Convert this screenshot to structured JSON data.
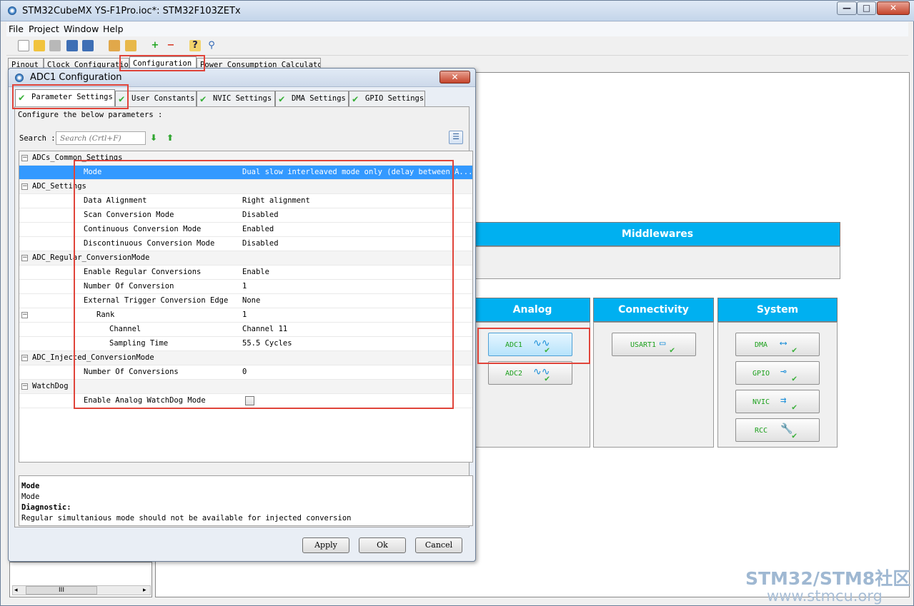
{
  "app": {
    "title": "STM32CubeMX YS-F1Pro.ioc*: STM32F103ZETx",
    "window_controls": {
      "minimize": "—",
      "maximize": "□",
      "close": "✕"
    }
  },
  "menu": [
    "File",
    "Project",
    "Window",
    "Help"
  ],
  "main_tabs": [
    "Pinout",
    "Clock Configuration",
    "Configuration",
    "Power Consumption Calculator"
  ],
  "categories": {
    "middlewares": "Middlewares",
    "analog": "Analog",
    "connectivity": "Connectivity",
    "system": "System"
  },
  "peripherals": {
    "adc1": "ADC1",
    "adc2": "ADC2",
    "usart1": "USART1",
    "dma": "DMA",
    "gpio": "GPIO",
    "nvic": "NVIC",
    "rcc": "RCC"
  },
  "dialog": {
    "title": "ADC1 Configuration",
    "close": "✕",
    "tabs": [
      "Parameter Settings",
      "User Constants",
      "NVIC Settings",
      "DMA Settings",
      "GPIO Settings"
    ],
    "configure_label": "Configure the below parameters :",
    "search_label": "Search :",
    "search_placeholder": "Search (Crtl+F)",
    "rows": [
      {
        "name": "ADCs_Common_Settings",
        "value": ""
      },
      {
        "name": "Mode",
        "value": "Dual slow interleaved mode only (delay between A..."
      },
      {
        "name": "ADC_Settings",
        "value": ""
      },
      {
        "name": "Data Alignment",
        "value": "Right alignment"
      },
      {
        "name": "Scan Conversion Mode",
        "value": "Disabled"
      },
      {
        "name": "Continuous Conversion Mode",
        "value": "Enabled"
      },
      {
        "name": "Discontinuous Conversion Mode",
        "value": "Disabled"
      },
      {
        "name": "ADC_Regular_ConversionMode",
        "value": ""
      },
      {
        "name": "Enable Regular Conversions",
        "value": "Enable"
      },
      {
        "name": "Number Of Conversion",
        "value": "1"
      },
      {
        "name": "External Trigger Conversion Edge",
        "value": "None"
      },
      {
        "name": "Rank",
        "value": "1"
      },
      {
        "name": "Channel",
        "value": "Channel 11"
      },
      {
        "name": "Sampling Time",
        "value": "55.5 Cycles"
      },
      {
        "name": "ADC_Injected_ConversionMode",
        "value": ""
      },
      {
        "name": "Number Of Conversions",
        "value": "0"
      },
      {
        "name": "WatchDog",
        "value": ""
      },
      {
        "name": "Enable Analog WatchDog Mode",
        "value": ""
      }
    ],
    "description": {
      "title": "Mode",
      "text": "Mode",
      "diagnostic_label": "Diagnostic:",
      "diagnostic_text": "Regular simultanious mode should not be available for injected conversion"
    },
    "buttons": {
      "apply": "Apply",
      "ok": "Ok",
      "cancel": "Cancel"
    }
  },
  "scrollbar_grip": "III",
  "watermark": {
    "brand": "STM32/STM8社区",
    "url": "www.stmcu.org"
  }
}
